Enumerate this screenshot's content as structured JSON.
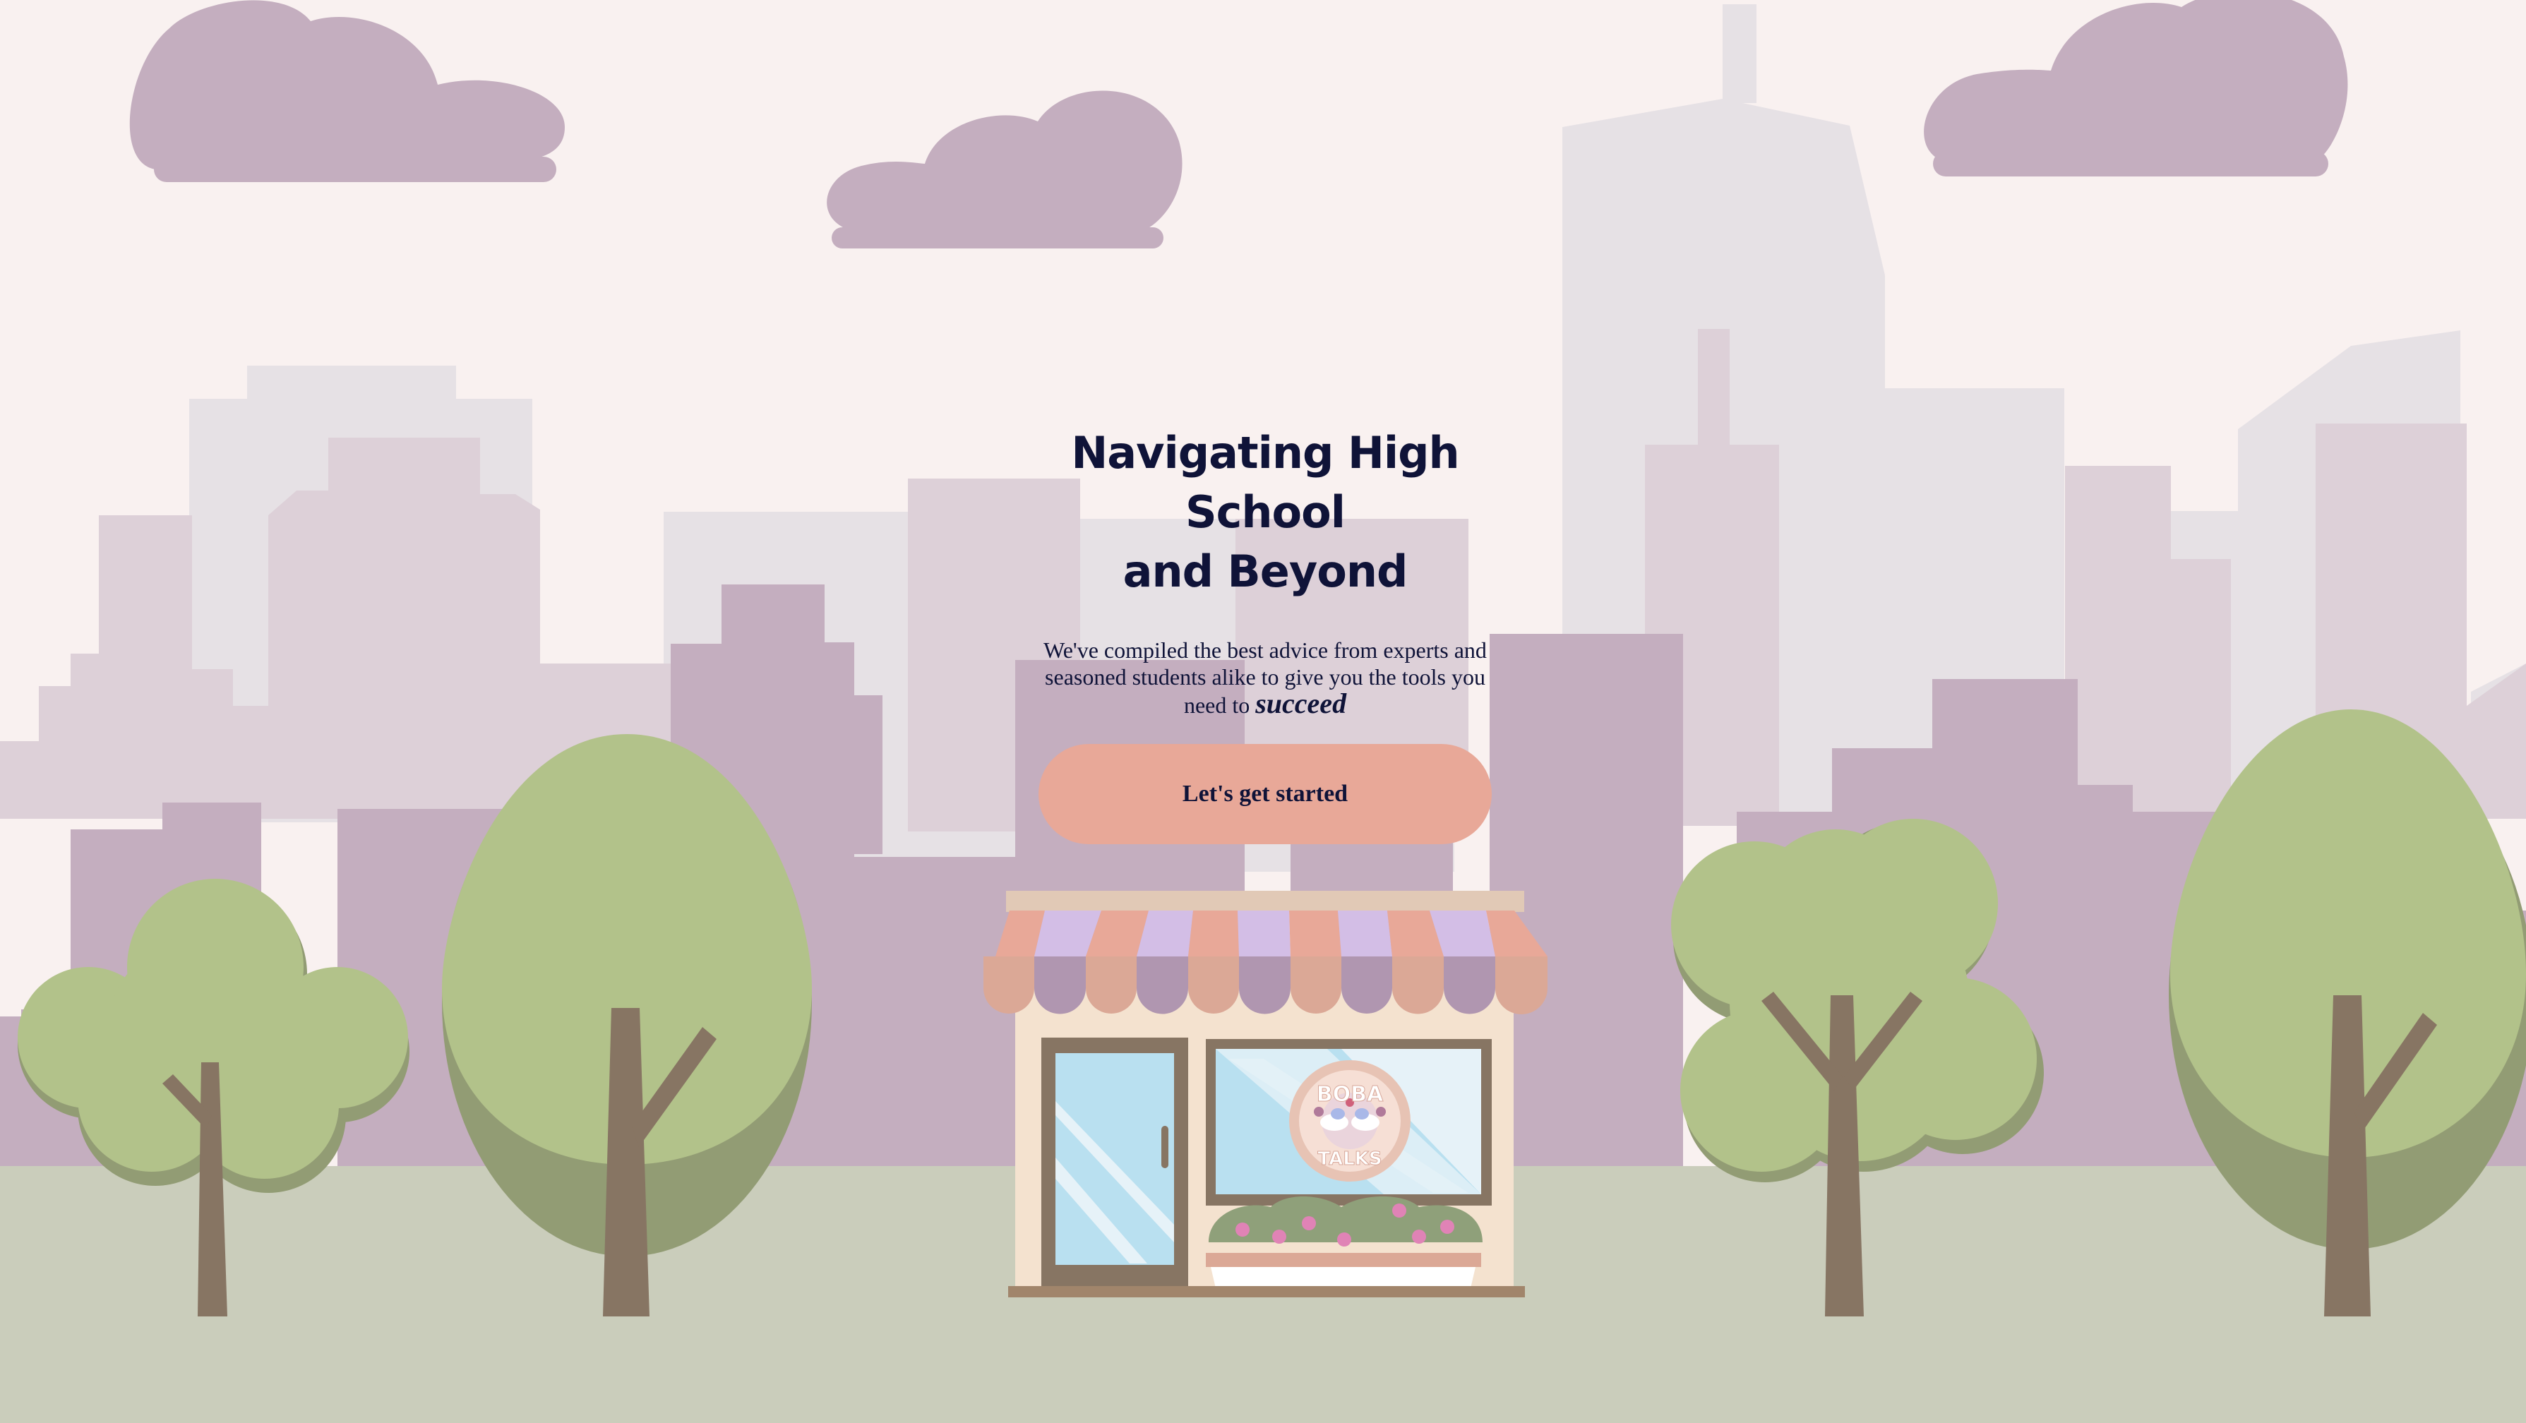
{
  "hero": {
    "title_line1": "Navigating High School",
    "title_line2": "and Beyond",
    "description": "We've compiled the best advice from experts and seasoned students alike to give you the tools you need to ",
    "emphasis": "succeed",
    "cta_label": "Let's get started"
  },
  "shop": {
    "logo_top": "BOBA",
    "logo_bottom": "TALKS"
  },
  "colors": {
    "sky": "#f9f1f0",
    "cloud": "#c4aebf",
    "building_far": "#e6e1e5",
    "building_mid": "#ddd0d8",
    "building_near": "#c4aebf",
    "ground": "#cacdbb",
    "tree": "#b2c28a",
    "tree_shadow": "#929c74",
    "trunk": "#877563",
    "button": "#e8a898",
    "text": "#0f1338"
  }
}
